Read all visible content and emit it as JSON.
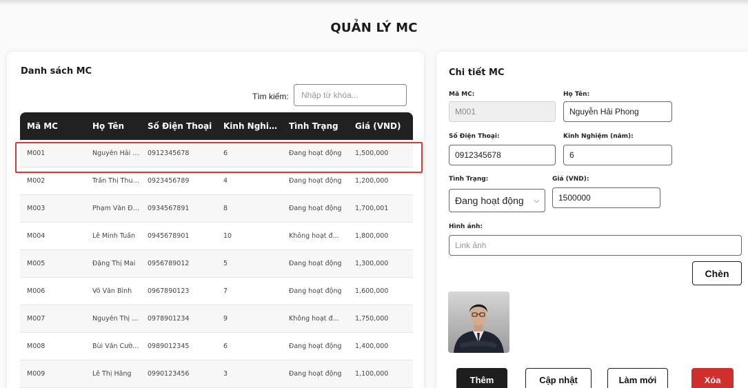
{
  "page": {
    "title": "QUẢN LÝ MC"
  },
  "list": {
    "title": "Danh sách MC",
    "search_label": "Tìm kiếm:",
    "search_placeholder": "Nhập từ khóa...",
    "columns": [
      "Mã MC",
      "Họ Tên",
      "Số Điện Thoại",
      "Kinh Nghiệ...",
      "Tình Trạng",
      "Giá (VND)"
    ],
    "rows": [
      [
        "M001",
        "Nguyễn Hải P...",
        "0912345678",
        "6",
        "Đang hoạt động",
        "1,500,000"
      ],
      [
        "M002",
        "Trần Thị Thu Hà",
        "0923456789",
        "4",
        "Đang hoạt động",
        "1,200,000"
      ],
      [
        "M003",
        "Phạm Văn Đức.",
        "0934567891",
        "8",
        "Đang hoạt động",
        "1,700,001"
      ],
      [
        "M004",
        "Lê Minh Tuấn",
        "0945678901",
        "10",
        "Không hoạt đ...",
        "1,800,000"
      ],
      [
        "M005",
        "Đặng Thị Mai",
        "0956789012",
        "5",
        "Đang hoạt động",
        "1,300,000"
      ],
      [
        "M006",
        "Võ Văn Bình",
        "0967890123",
        "7",
        "Đang hoạt động",
        "1,600,000"
      ],
      [
        "M007",
        "Nguyễn Thị Lan",
        "0978901234",
        "9",
        "Không hoạt đ...",
        "1,750,000"
      ],
      [
        "M008",
        "Bùi Văn Cường",
        "0989012345",
        "6",
        "Đang hoạt động",
        "1,400,000"
      ],
      [
        "M009",
        "Lê Thị Hằng",
        "0990123456",
        "3",
        "Đang hoạt động",
        "1,100,000"
      ]
    ],
    "selected_row": 0
  },
  "detail": {
    "title": "Chi tiết MC",
    "code_label": "Mã MC:",
    "code_value": "M001",
    "name_label": "Họ Tên:",
    "name_value": "Nguyễn Hải Phong",
    "phone_label": "Số Điện Thoại:",
    "phone_value": "0912345678",
    "exp_label": "Kinh Nghiệm (năm):",
    "exp_value": "6",
    "status_label": "Tình Trạng:",
    "status_value": "Đang hoạt động",
    "price_label": "Giá (VND):",
    "price_value": "1500000",
    "image_label": "Hình ảnh:",
    "image_placeholder": "Link ảnh",
    "insert_button": "Chèn",
    "add_button": "Thêm",
    "update_button": "Cập nhật",
    "reset_button": "Làm mới",
    "delete_button": "Xóa"
  },
  "colors": {
    "header_bg": "#212121",
    "selection": "#e03636",
    "delete": "#d12e2e"
  },
  "icons": {
    "select_arrow": "chevron-down-icon",
    "photo": "mc-portrait-photo"
  }
}
